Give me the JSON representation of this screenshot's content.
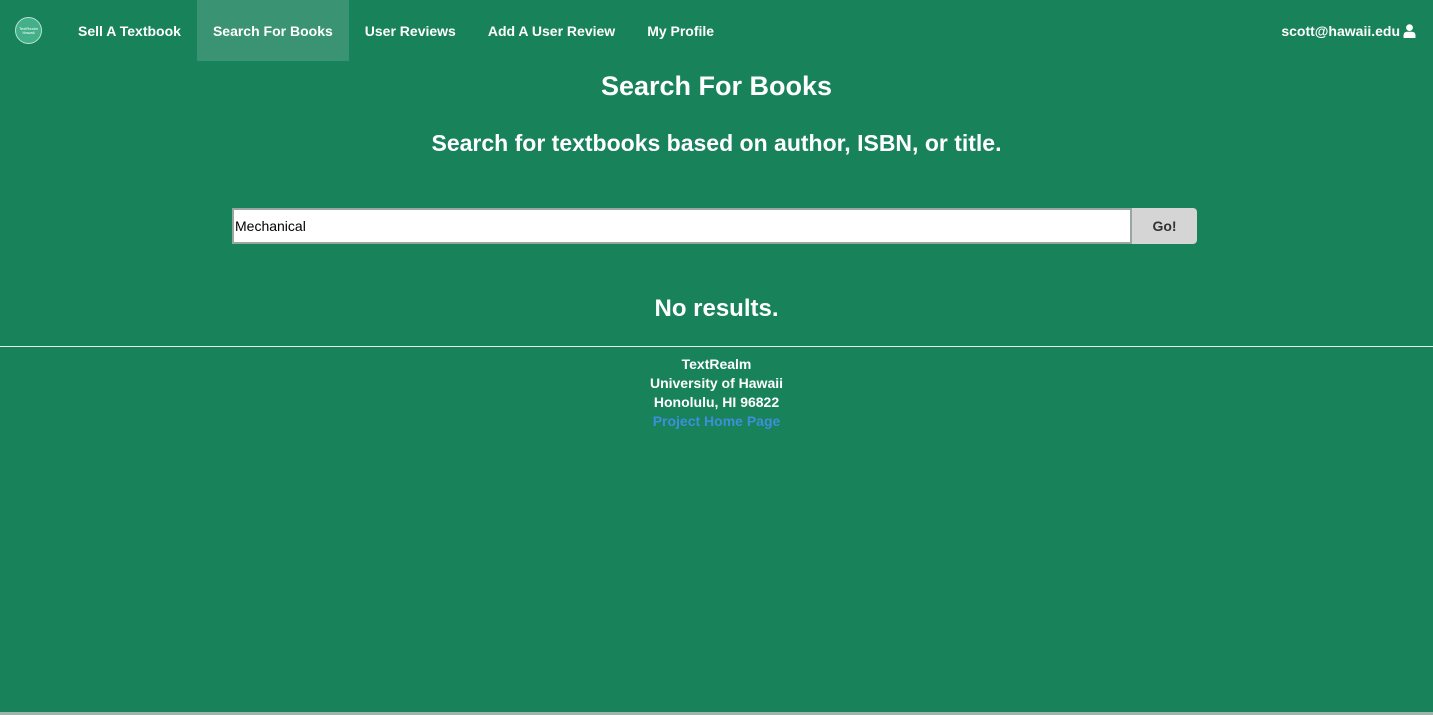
{
  "nav": {
    "logo_text_line1": "TextRealm",
    "logo_text_line2": "Hawaii",
    "items": [
      {
        "label": "Sell A Textbook",
        "active": false
      },
      {
        "label": "Search For Books",
        "active": true
      },
      {
        "label": "User Reviews",
        "active": false
      },
      {
        "label": "Add A User Review",
        "active": false
      },
      {
        "label": "My Profile",
        "active": false
      }
    ],
    "user_email": "scott@hawaii.edu",
    "user_icon": "user-icon"
  },
  "main": {
    "title": "Search For Books",
    "subtitle": "Search for textbooks based on author, ISBN, or title.",
    "search": {
      "value": "Mechanical",
      "placeholder": ""
    },
    "go_label": "Go!",
    "results_text": "No results."
  },
  "footer": {
    "line1": "TextRealm",
    "line2": "University of Hawaii",
    "line3": "Honolulu, HI 96822",
    "link_label": "Project Home Page"
  },
  "colors": {
    "background": "#18825b",
    "link": "#3e8fd9",
    "button": "#d5d5d5"
  }
}
